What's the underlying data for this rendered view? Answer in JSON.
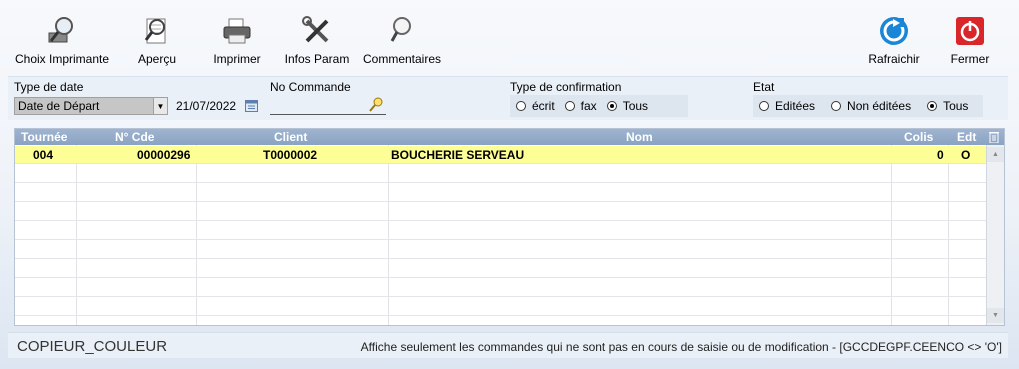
{
  "toolbar": {
    "choix_imprimante": "Choix Imprimante",
    "apercu": "Aperçu",
    "imprimer": "Imprimer",
    "infos_param": "Infos Param",
    "commentaires": "Commentaires",
    "rafraichir": "Rafraichir",
    "fermer": "Fermer"
  },
  "filters": {
    "type_date_label": "Type de date",
    "type_date_value": "Date de Départ",
    "date_value": "21/07/2022",
    "no_commande_label": "No Commande",
    "no_commande_value": "",
    "type_confirmation_label": "Type de confirmation",
    "confirmation_options": [
      "écrit",
      "fax",
      "Tous"
    ],
    "confirmation_selected": "Tous",
    "etat_label": "Etat",
    "etat_options": [
      "Editées",
      "Non éditées",
      "Tous"
    ],
    "etat_selected": "Tous"
  },
  "grid": {
    "columns": [
      "Tournée",
      "N° Cde",
      "Client",
      "Nom",
      "Colis",
      "Edt"
    ],
    "rows": [
      {
        "tournee": "004",
        "no_cde": "00000296",
        "client": "T0000002",
        "nom": "BOUCHERIE SERVEAU",
        "colis": "0",
        "edt": "O"
      }
    ]
  },
  "status": {
    "printer": "COPIEUR_COULEUR",
    "message": "Affiche seulement les commandes qui ne sont pas en cours de saisie ou de modification - [GCCDEGPF.CEENCO <> 'O']"
  },
  "colors": {
    "header_bg": "#8aa3c3",
    "selected_row": "#fdfe96",
    "close_red": "#d9262a",
    "refresh_blue": "#1c86d6"
  }
}
